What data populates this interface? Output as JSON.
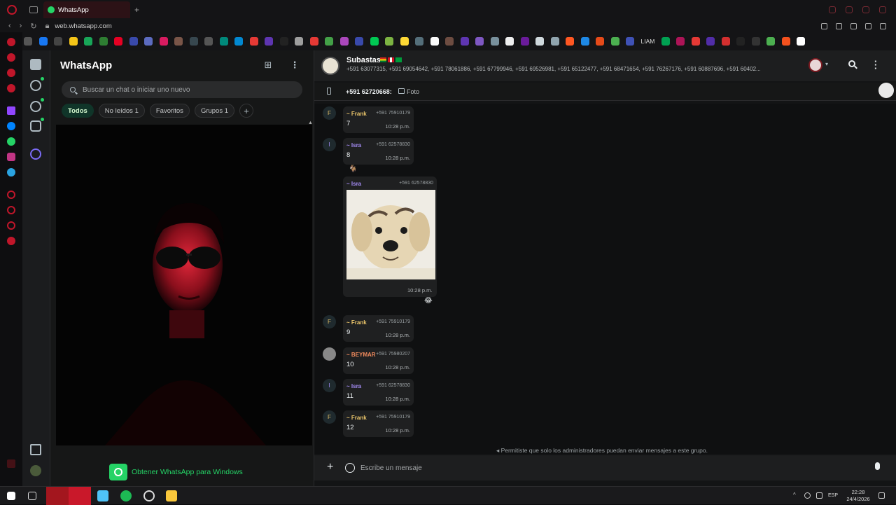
{
  "browser": {
    "tab_title": "WhatsApp",
    "url": "web.whatsapp.com",
    "bookmark_label": "LIAM"
  },
  "sidebar": {
    "title": "WhatsApp",
    "search_placeholder": "Buscar un chat o iniciar uno nuevo",
    "filters": [
      "Todos",
      "No leídos 1",
      "Favoritos",
      "Grupos 1"
    ],
    "promo_text": "Obtener WhatsApp para Windows"
  },
  "chat": {
    "group_name": "Subastas",
    "members": "+591 63077315, +591 69054642, +591 78061886, +591 67799946, +591 69526981, +591 65122477, +591 68471654, +591 76267176, +591 60887696, +591 60402...",
    "pinned_sender": "+591 62720668:",
    "pinned_text": "Foto",
    "messages": [
      {
        "initial": "F",
        "sender": "~ Frank",
        "phone": "+591 75910179",
        "text": "7",
        "time": "10:28 p.m.",
        "color": "#e9c46a"
      },
      {
        "initial": "I",
        "sender": "~ Isra",
        "phone": "+591 62578830",
        "text": "8",
        "time": "10:28 p.m.",
        "color": "#a58cf5"
      },
      {
        "initial": "",
        "sender": "~ Isra",
        "phone": "+591 62578830",
        "text": "",
        "time": "10:28 p.m.",
        "color": "#a58cf5"
      },
      {
        "initial": "F",
        "sender": "~ Frank",
        "phone": "+591 75910179",
        "text": "9",
        "time": "10:28 p.m.",
        "color": "#e9c46a"
      },
      {
        "initial": "",
        "sender": "~ BEYMAR",
        "phone": "+591 75980207",
        "text": "10",
        "time": "10:28 p.m.",
        "color": "#f08a5d"
      },
      {
        "initial": "I",
        "sender": "~ Isra",
        "phone": "+591 62578830",
        "text": "11",
        "time": "10:28 p.m.",
        "color": "#a58cf5"
      },
      {
        "initial": "F",
        "sender": "~ Frank",
        "phone": "+591 75910179",
        "text": "12",
        "time": "10:28 p.m.",
        "color": "#e9c46a"
      }
    ],
    "reactions": [
      "🐐",
      "😂"
    ],
    "admin_notice": "Permitiste que solo los administradores puedan enviar mensajes a este grupo.",
    "compose_placeholder": "Escribe un mensaje"
  },
  "taskbar": {
    "lang": "ESP",
    "time": "22:28",
    "date": "24/4/2026"
  }
}
